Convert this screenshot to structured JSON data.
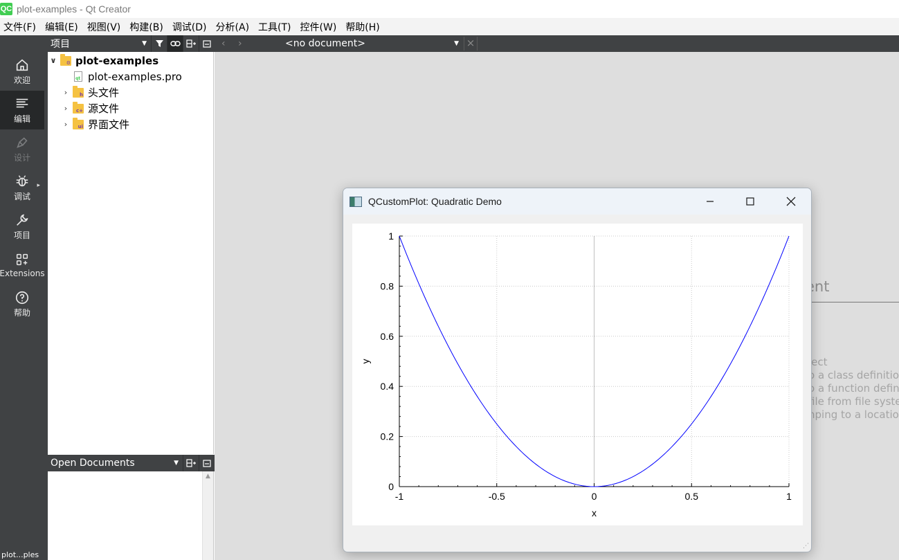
{
  "window": {
    "title": "plot-examples - Qt Creator",
    "logo_text": "QC"
  },
  "menubar": {
    "items": [
      {
        "label": "文件(F)"
      },
      {
        "label": "编辑(E)"
      },
      {
        "label": "视图(V)"
      },
      {
        "label": "构建(B)"
      },
      {
        "label": "调试(D)"
      },
      {
        "label": "分析(A)"
      },
      {
        "label": "工具(T)"
      },
      {
        "label": "控件(W)"
      },
      {
        "label": "帮助(H)"
      }
    ]
  },
  "modebar": {
    "modes": [
      {
        "label": "欢迎",
        "icon": "home-icon"
      },
      {
        "label": "编辑",
        "icon": "edit-icon",
        "active": true
      },
      {
        "label": "设计",
        "icon": "design-icon",
        "disabled": true
      },
      {
        "label": "调试",
        "icon": "bug-icon"
      },
      {
        "label": "项目",
        "icon": "wrench-icon"
      },
      {
        "label": "Extensions",
        "icon": "extensions-icon"
      },
      {
        "label": "帮助",
        "icon": "help-icon"
      }
    ],
    "session_label": "plot...ples"
  },
  "project_pane": {
    "title": "项目",
    "tree": [
      {
        "label": "plot-examples",
        "level": 0,
        "expanded": true,
        "type": "project",
        "bold": true
      },
      {
        "label": "plot-examples.pro",
        "level": 1,
        "type": "file"
      },
      {
        "label": "头文件",
        "level": 1,
        "type": "folder",
        "badge": "h"
      },
      {
        "label": "源文件",
        "level": 1,
        "type": "folder",
        "badge": "c+"
      },
      {
        "label": "界面文件",
        "level": 1,
        "type": "folder",
        "badge": "ui"
      }
    ]
  },
  "open_documents": {
    "title": "Open Documents"
  },
  "editor": {
    "document_selector": "<no document>",
    "hint_title": "ent",
    "hints": [
      "ject",
      "o a class definition",
      "o a function definiti",
      "file from file system",
      "nping to a location"
    ]
  },
  "plot_window": {
    "title": "QCustomPlot: Quadratic Demo",
    "minimize_glyph": "—",
    "maximize_glyph": "☐",
    "close_glyph": "✕"
  },
  "chart_data": {
    "type": "line",
    "title": "",
    "xlabel": "x",
    "ylabel": "y",
    "xlim": [
      -1,
      1
    ],
    "ylim": [
      0,
      1
    ],
    "xticks": [
      "-1",
      "-0.5",
      "0",
      "0.5",
      "1"
    ],
    "yticks": [
      "0",
      "0.2",
      "0.4",
      "0.6",
      "0.8",
      "1"
    ],
    "grid": true,
    "series": [
      {
        "color": "#0000ff",
        "x": [
          -1,
          -0.9,
          -0.8,
          -0.7,
          -0.6,
          -0.5,
          -0.4,
          -0.3,
          -0.2,
          -0.1,
          0,
          0.1,
          0.2,
          0.3,
          0.4,
          0.5,
          0.6,
          0.7,
          0.8,
          0.9,
          1
        ],
        "y": [
          1,
          0.81,
          0.64,
          0.49,
          0.36,
          0.25,
          0.16,
          0.09,
          0.04,
          0.01,
          0,
          0.01,
          0.04,
          0.09,
          0.16,
          0.25,
          0.36,
          0.49,
          0.64,
          0.81,
          1
        ]
      }
    ]
  }
}
